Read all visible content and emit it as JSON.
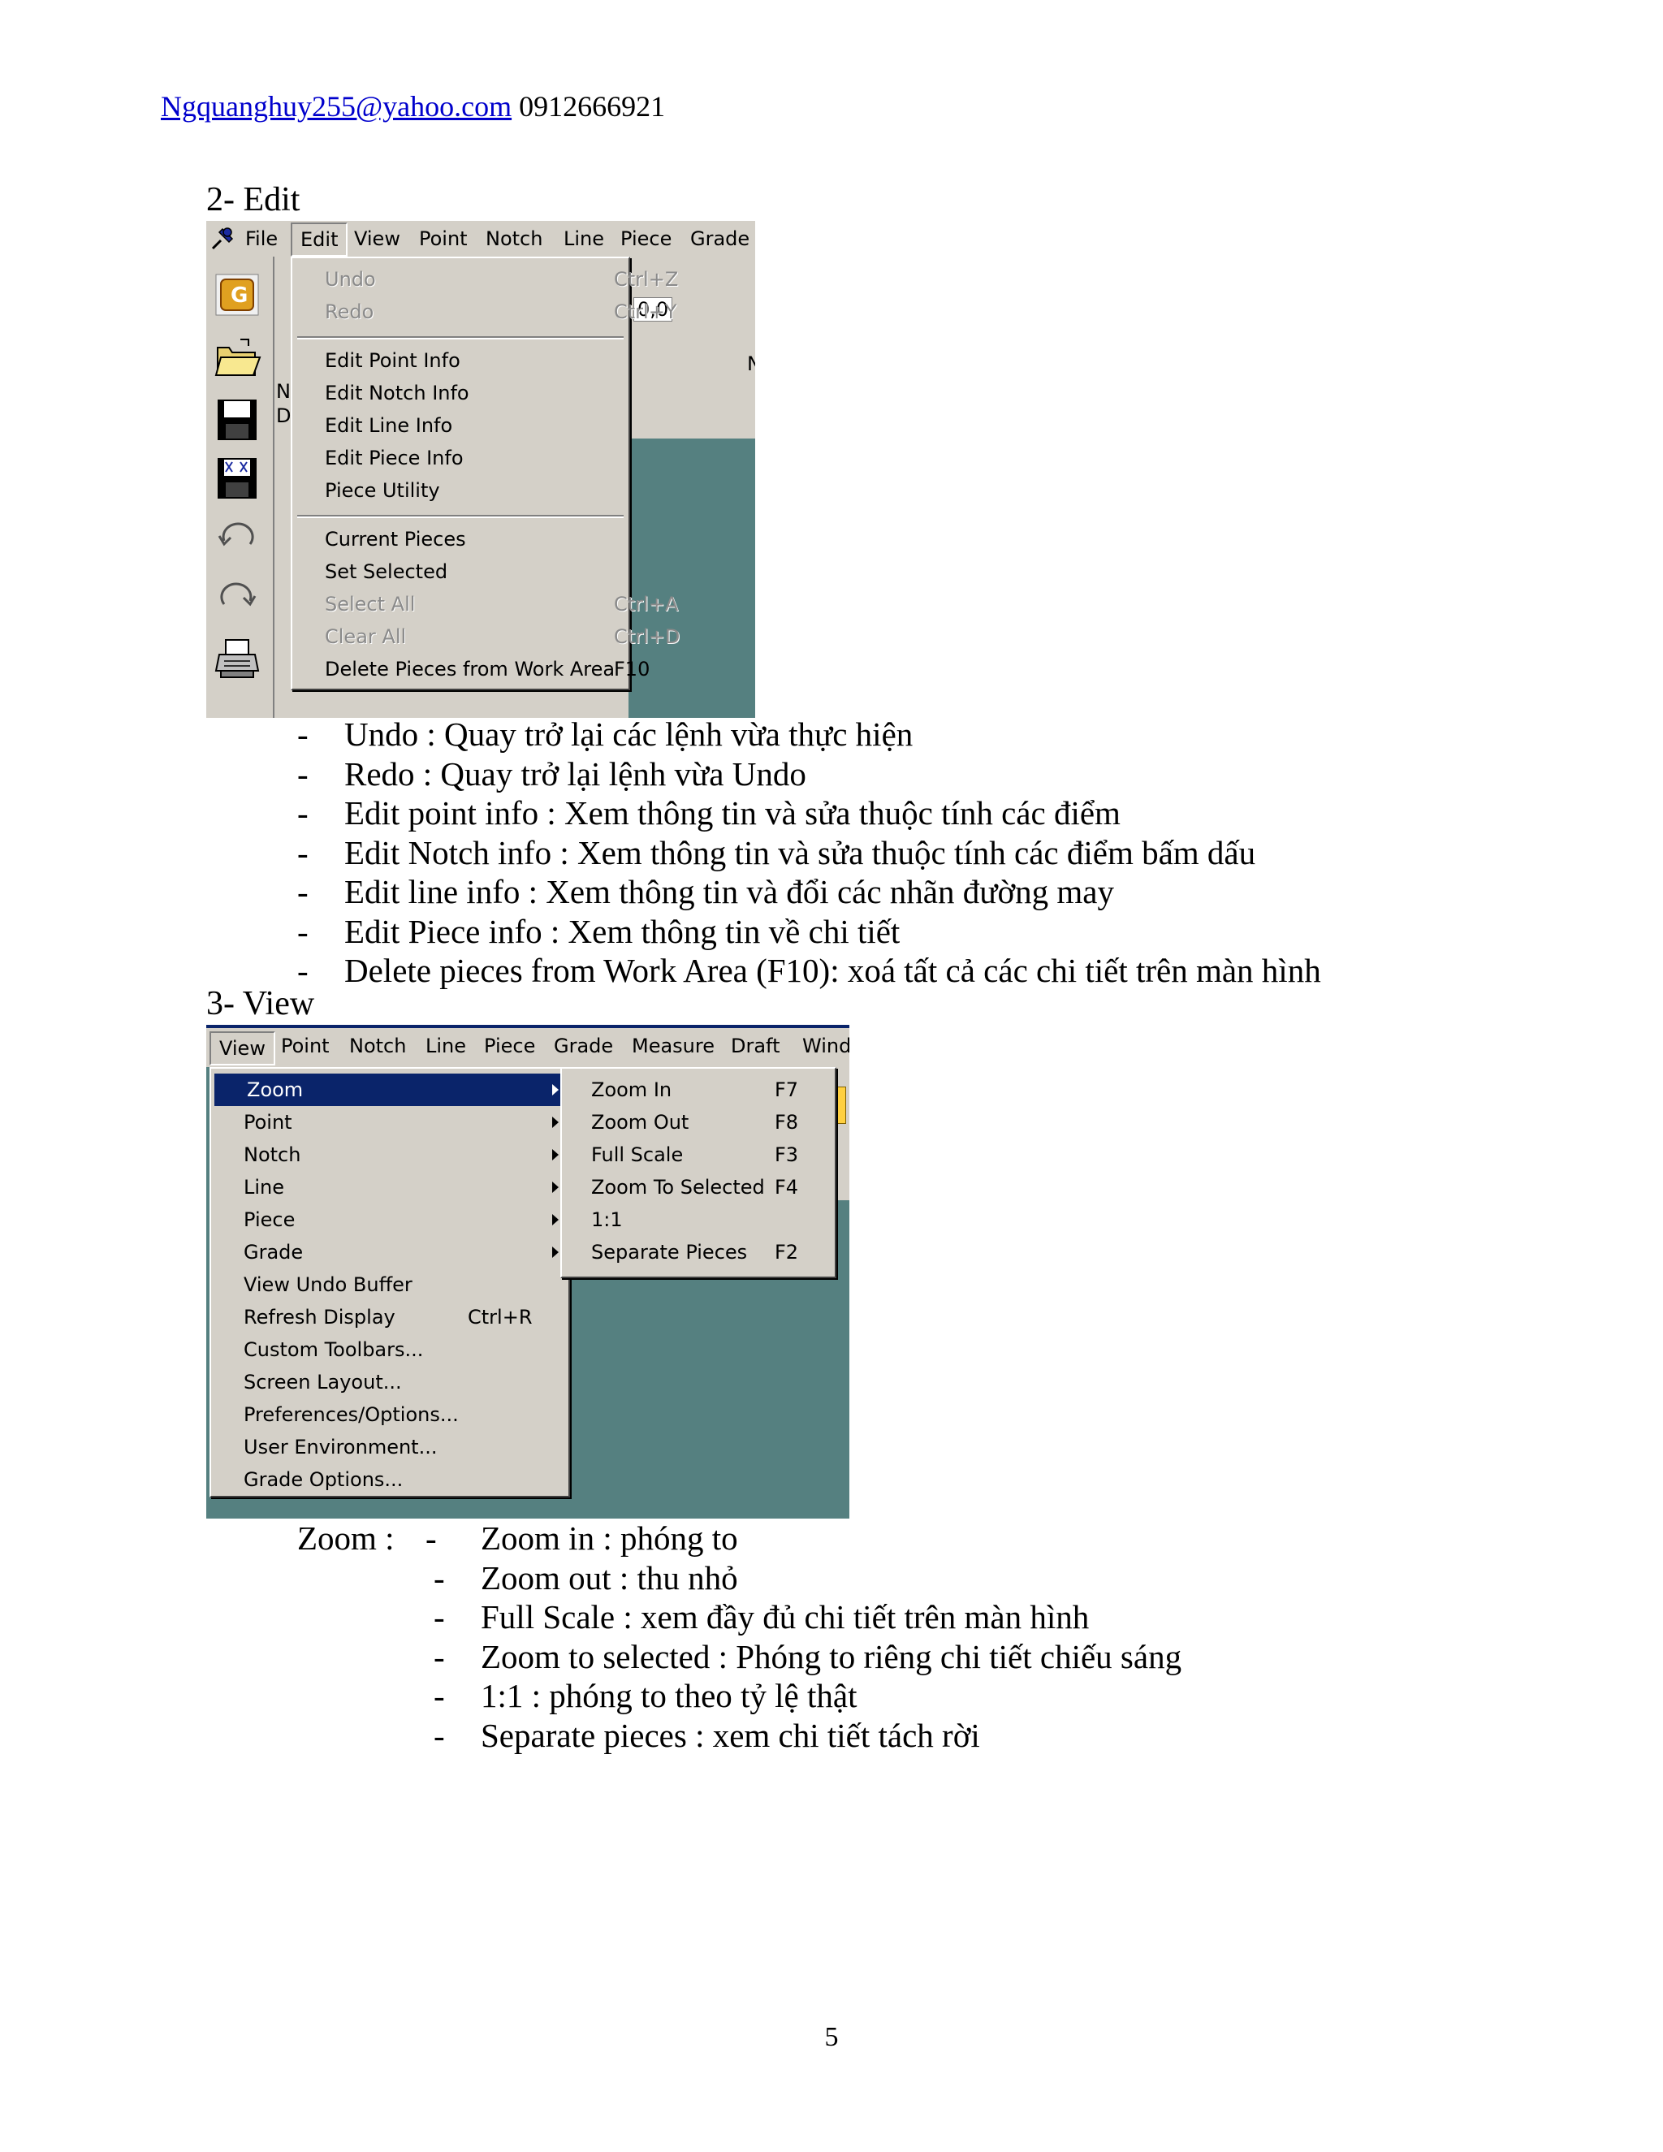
{
  "header": {
    "email": "Ngquanghuy255@yahoo.com",
    "phone": "0912666921"
  },
  "section_edit": {
    "heading": "2-  Edit",
    "menubar": [
      "File",
      "Edit",
      "View",
      "Point",
      "Notch",
      "Line",
      "Piece",
      "Grade"
    ],
    "status_text": "0,0",
    "side_letters": [
      "N",
      "D",
      "N"
    ],
    "menu": {
      "undo": {
        "label": "Undo",
        "shortcut": "Ctrl+Z"
      },
      "redo": {
        "label": "Redo",
        "shortcut": "Ctrl+Y"
      },
      "edit_point": "Edit Point Info",
      "edit_notch": "Edit Notch Info",
      "edit_line": "Edit Line Info",
      "edit_piece": "Edit Piece Info",
      "piece_utility": "Piece Utility",
      "current_pieces": "Current Pieces",
      "set_selected": "Set Selected",
      "select_all": {
        "label": "Select All",
        "shortcut": "Ctrl+A"
      },
      "clear_all": {
        "label": "Clear All",
        "shortcut": "Ctrl+D"
      },
      "delete_pieces": {
        "label": "Delete Pieces from Work Area",
        "shortcut": "F10"
      }
    },
    "icons": [
      "pin-icon",
      "folder-open-icon",
      "save-icon",
      "save-close-icon",
      "undo-icon",
      "redo-icon",
      "print-icon",
      "grade-icon"
    ],
    "bullets": [
      "Undo : Quay trở lại các lệnh vừa thực hiện",
      "Redo : Quay trở lại lệnh vừa Undo",
      "Edit point info : Xem thông tin và sửa thuộc tính các điểm",
      "Edit Notch info : Xem thông tin và sửa thuộc tính các điểm bấm dấu",
      "Edit line info : Xem thông tin và đổi các nhãn đường may",
      "Edit Piece info : Xem thông tin về chi tiết",
      "Delete pieces from Work Area (F10): xoá tất cả các chi tiết trên màn hình"
    ]
  },
  "section_view": {
    "heading": "3-  View",
    "menubar": [
      "View",
      "Point",
      "Notch",
      "Line",
      "Piece",
      "Grade",
      "Measure",
      "Draft",
      "Wind"
    ],
    "menu": {
      "zoom": "Zoom",
      "point": "Point",
      "notch": "Notch",
      "line": "Line",
      "piece": "Piece",
      "grade": "Grade",
      "view_undo_buffer": "View Undo Buffer",
      "refresh_display": {
        "label": "Refresh Display",
        "shortcut": "Ctrl+R"
      },
      "custom_toolbars": "Custom Toolbars...",
      "screen_layout": "Screen Layout...",
      "preferences": "Preferences/Options...",
      "user_environment": "User Environment...",
      "grade_options": "Grade Options..."
    },
    "submenu": {
      "zoom_in": {
        "label": "Zoom In",
        "shortcut": "F7"
      },
      "zoom_out": {
        "label": "Zoom Out",
        "shortcut": "F8"
      },
      "full_scale": {
        "label": "Full Scale",
        "shortcut": "F3"
      },
      "zoom_selected": {
        "label": "Zoom To Selected",
        "shortcut": "F4"
      },
      "one_to_one": {
        "label": "1:1",
        "shortcut": ""
      },
      "separate": {
        "label": "Separate Pieces",
        "shortcut": "F2"
      }
    },
    "zoom_label": "Zoom :",
    "bullets": [
      "Zoom in : phóng to",
      "Zoom out : thu nhỏ",
      "Full Scale : xem đầy đủ chi tiết trên màn hình",
      "Zoom to selected : Phóng to riêng chi tiết chiếu sáng",
      "1:1 : phóng to theo tỷ lệ thật",
      "Separate pieces : xem chi tiết tách rời"
    ]
  },
  "dash": "-",
  "page_number": "5"
}
